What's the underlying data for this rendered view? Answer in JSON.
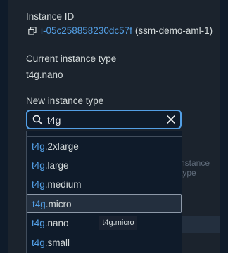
{
  "instance_id": {
    "label": "Instance ID",
    "id": "i-05c258858230dc57f",
    "name": "(ssm-demo-aml-1)"
  },
  "current_type": {
    "label": "Current instance type",
    "value": "t4g.nano"
  },
  "new_type": {
    "label": "New instance type",
    "search_value": "t4g"
  },
  "options": [
    {
      "match": "t4g",
      "rest": ".2xlarge"
    },
    {
      "match": "t4g",
      "rest": ".large"
    },
    {
      "match": "t4g",
      "rest": ".medium"
    },
    {
      "match": "t4g",
      "rest": ".micro"
    },
    {
      "match": "t4g",
      "rest": ".nano"
    },
    {
      "match": "t4g",
      "rest": ".small"
    }
  ],
  "tooltip": "t4g.micro",
  "background_hint": "nstance type",
  "colors": {
    "accent": "#539fe5",
    "background": "#0f1b2a",
    "panel": "#1b232d"
  },
  "icons": {
    "copy": "copy-icon",
    "search": "search-icon",
    "clear": "close-icon"
  }
}
